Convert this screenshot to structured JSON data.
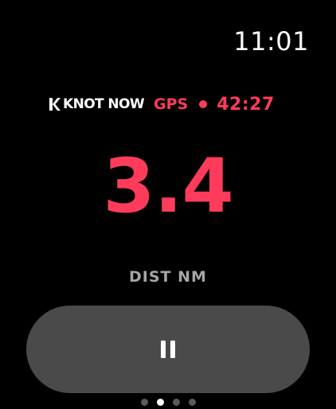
{
  "status_bar": {
    "time": "11:01"
  },
  "workout_header": {
    "app_name": "KNOT NOW",
    "app_icon": "k-logo-icon",
    "signal_label": "GPS",
    "recording_indicator": "red-dot-icon",
    "elapsed_time": "42:27"
  },
  "metric": {
    "value": "3.4",
    "label": "DIST NM"
  },
  "controls": {
    "pause_icon": "pause-icon"
  },
  "pager": {
    "count": 4,
    "active_index": 1
  },
  "colors": {
    "background": "#000000",
    "accent": "#ff3b5c",
    "label_gray": "#a6a6a6",
    "button_bg": "#4a4a4a",
    "text": "#ffffff"
  }
}
